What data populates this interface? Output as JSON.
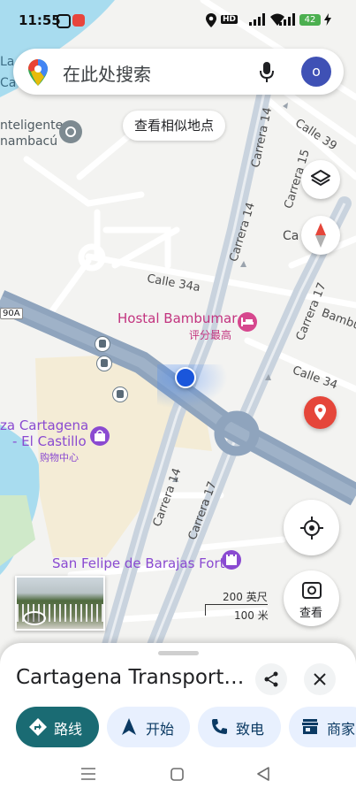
{
  "status_bar": {
    "time": "11:55",
    "hd_label": "HD",
    "signal_label": "5G",
    "battery": "42"
  },
  "search": {
    "placeholder": "在此处搜索",
    "avatar_letter": "o"
  },
  "chip": {
    "label": "查看相似地点"
  },
  "map_labels": {
    "streets": [
      "Calle 39",
      "Carrera 15",
      "Carrera 14",
      "Calle 34a",
      "Carrera 17",
      "Calle 34",
      "Carrera 14",
      "Carrera 17"
    ],
    "edge_fragments": [
      "La",
      "Ca",
      "Ca",
      "Ca",
      "90A"
    ],
    "poi_left": [
      "nteligente",
      "nambacú"
    ],
    "hostal_name": "Hostal Bambumar",
    "hostal_sub": "评分最高",
    "plaza_line1": "za Cartagena",
    "plaza_line2": "- El Castillo",
    "plaza_sub": "购物中心",
    "fort": "San Felipe de Barajas Fort",
    "scale_top": "200 英尺",
    "scale_bottom": "100 米"
  },
  "view_button": {
    "label": "查看"
  },
  "sheet": {
    "title": "Cartagena Transport…",
    "actions": [
      {
        "label": "路线",
        "icon": "directions-icon"
      },
      {
        "label": "开始",
        "icon": "navigation-arrow-icon"
      },
      {
        "label": "致电",
        "icon": "phone-icon"
      },
      {
        "label": "商家",
        "icon": "store-icon"
      }
    ]
  },
  "colors": {
    "accent": "#1a6b73",
    "water": "#a8dcef",
    "highway": "#8fa4bd",
    "location": "#1a56db",
    "pin": "#e5463a"
  }
}
